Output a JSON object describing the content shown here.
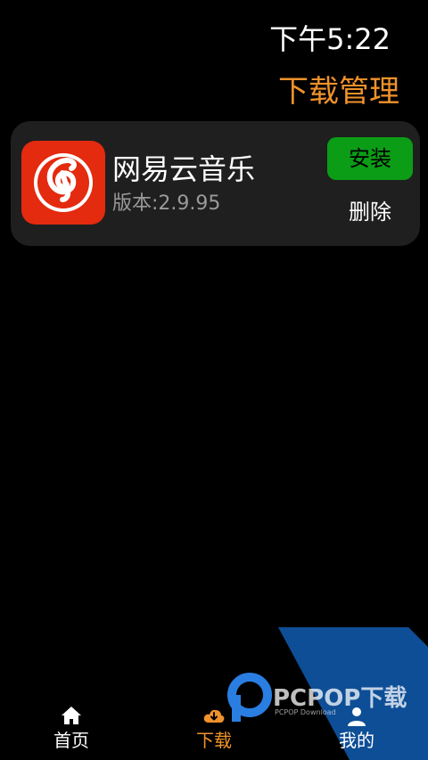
{
  "status_bar": {
    "time": "下午5:22"
  },
  "header": {
    "title": "下载管理"
  },
  "download_list": [
    {
      "name": "网易云音乐",
      "version": "版本:2.9.95",
      "icon": "netease-music-icon",
      "install_label": "安装",
      "delete_label": "删除"
    }
  ],
  "bottom_nav": {
    "items": [
      {
        "label": "首页",
        "icon": "home-icon"
      },
      {
        "label": "下载",
        "icon": "download-cloud-icon",
        "active": true
      },
      {
        "label": "我的",
        "icon": "user-icon"
      }
    ]
  },
  "watermark": {
    "text": "PCPOP下载",
    "subtext": "PCPOP Download"
  },
  "colors": {
    "background": "#000000",
    "accent": "#f0922b",
    "card": "#1f1f1f",
    "install_green": "#0b9d16",
    "app_icon_red": "#e42a0f",
    "version_gray": "#9a9a9a",
    "watermark_blue": "#0e4e96"
  }
}
